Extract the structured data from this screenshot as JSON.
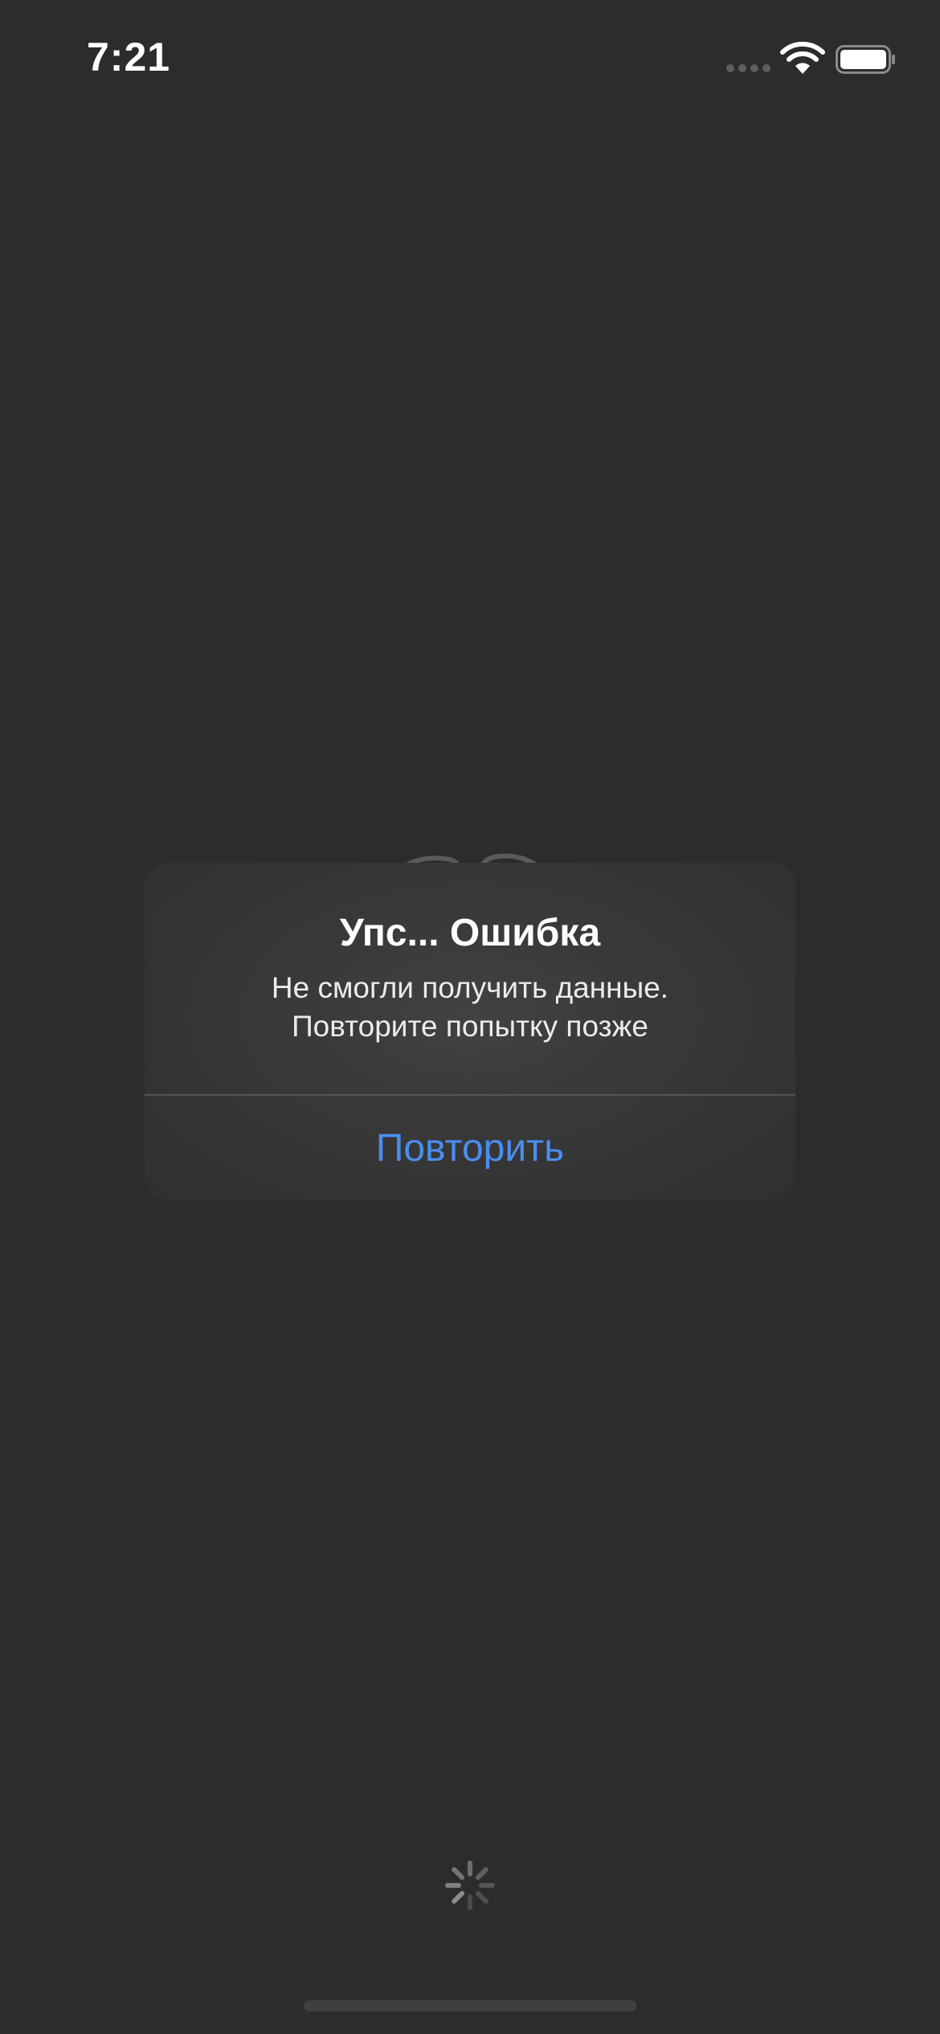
{
  "status_bar": {
    "time": "7:21",
    "signal_icon": "cellular-signal-icon",
    "wifi_icon": "wifi-icon",
    "battery_icon": "battery-full-icon"
  },
  "alert": {
    "title": "Упс... Ошибка",
    "message_line1": "Не смогли получить данные.",
    "message_line2": "Повторите попытку позже",
    "retry_label": "Повторить"
  },
  "loading": {
    "spinner_icon": "activity-spinner-icon"
  },
  "colors": {
    "background": "#2c2c2c",
    "alert_background": "#3a3a3a",
    "accent": "#4a8ef0",
    "text_primary": "#ffffff"
  }
}
